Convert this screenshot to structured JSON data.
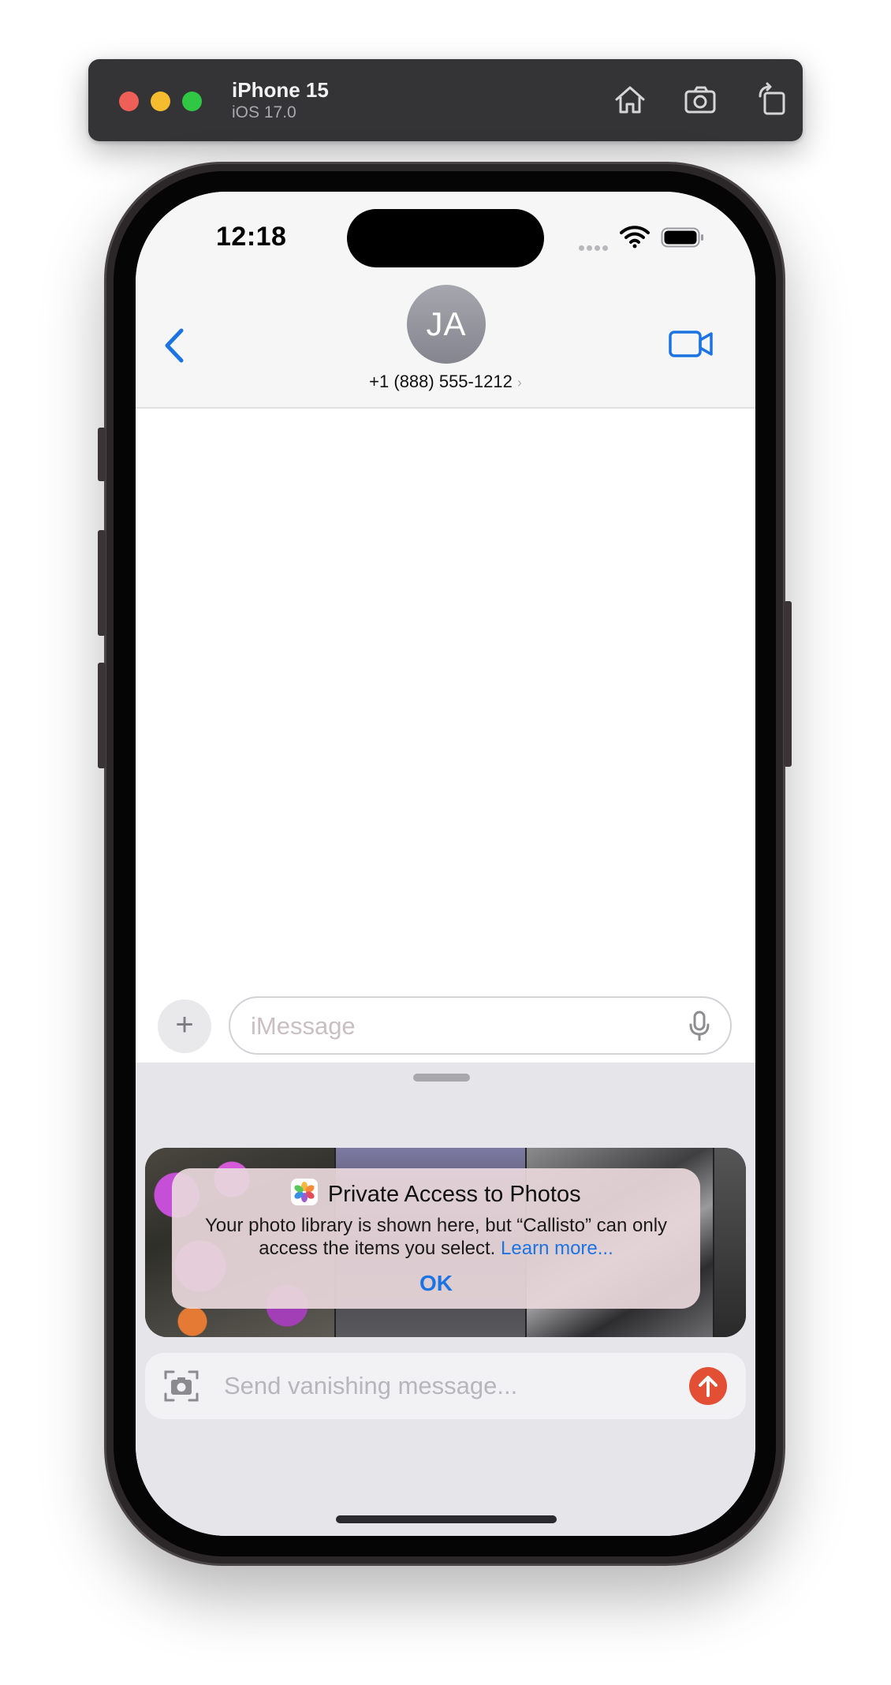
{
  "simulator": {
    "device_name": "iPhone 15",
    "os_version": "iOS 17.0",
    "toolbar_icons": [
      "home-icon",
      "screenshot-icon",
      "rotate-icon"
    ]
  },
  "status_bar": {
    "time": "12:18",
    "icons": [
      "signal-dots-icon",
      "wifi-icon",
      "battery-icon"
    ]
  },
  "conversation_header": {
    "avatar_initials": "JA",
    "contact": "+1 (888) 555-1212",
    "contact_chevron": "›",
    "back_icon": "chevron-left-icon",
    "video_icon": "video-camera-icon"
  },
  "composer": {
    "plus_label": "+",
    "placeholder": "iMessage",
    "mic_icon": "microphone-icon"
  },
  "photo_sheet": {
    "alert": {
      "title": "Private Access to Photos",
      "body": "Your photo library is shown here, but “Callisto” can only access the items you select.",
      "link": "Learn more...",
      "ok": "OK"
    },
    "vanishing_placeholder": "Send vanishing message...",
    "camera_icon": "camera-icon",
    "send_icon": "arrow-up-icon"
  },
  "colors": {
    "accent_blue": "#1c74e3",
    "send_red": "#e24f35",
    "toolbar_bg": "#343437"
  }
}
